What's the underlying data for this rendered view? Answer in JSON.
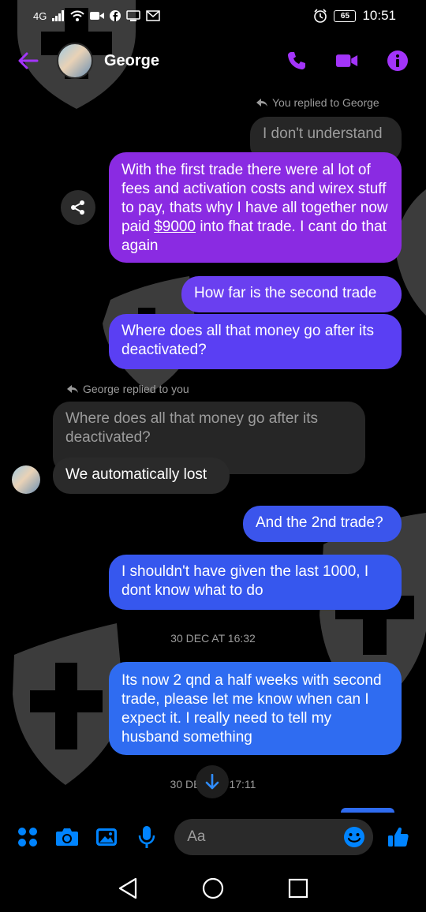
{
  "status": {
    "time": "10:51",
    "battery": "65",
    "network": "4G"
  },
  "header": {
    "contact_name": "George"
  },
  "messages": {
    "reply_note_1": "You replied to George",
    "quote_1": "I don't understand",
    "msg_1_part1": "With the first trade there were al lot of fees and activation costs and wirex stuff to pay, thats why I have all together now paid ",
    "msg_1_amount": "$9000",
    "msg_1_part2": " into fhat trade. I cant do that again",
    "msg_2": "How far is the second trade",
    "msg_3": "Where does all that money go after its deactivated?",
    "reply_note_2": "George replied to you",
    "quote_2": "Where does all that money go after its deactivated?",
    "msg_4": "We automatically lost",
    "msg_5": "And the 2nd trade?",
    "msg_6": "I shouldn't have given the last 1000, I dont know what to do",
    "timestamp_1": "30 DEC AT 16:32",
    "msg_7": "Its now 2 qnd a half weeks with second trade, please let me know when can I expect it. I really need to tell my husband something",
    "timestamp_2_left": "30 DE",
    "timestamp_2_right": "17:11"
  },
  "composer": {
    "placeholder": "Aa"
  },
  "icons": {
    "back": "back-arrow-icon",
    "call": "phone-icon",
    "video": "video-camera-icon",
    "info": "info-icon",
    "share": "share-icon",
    "apps": "apps-icon",
    "camera": "camera-icon",
    "gallery": "image-icon",
    "mic": "microphone-icon",
    "emoji": "emoji-icon",
    "like": "thumbs-up-icon",
    "scroll": "arrow-down-icon",
    "nav_back": "triangle-back-icon",
    "nav_home": "circle-home-icon",
    "nav_recent": "square-recent-icon"
  },
  "colors": {
    "accent_purple": "#a334fa",
    "bubble_purple": "#8a2be2",
    "bubble_blue": "#2f5ff1",
    "messenger_blue": "#0084ff"
  }
}
